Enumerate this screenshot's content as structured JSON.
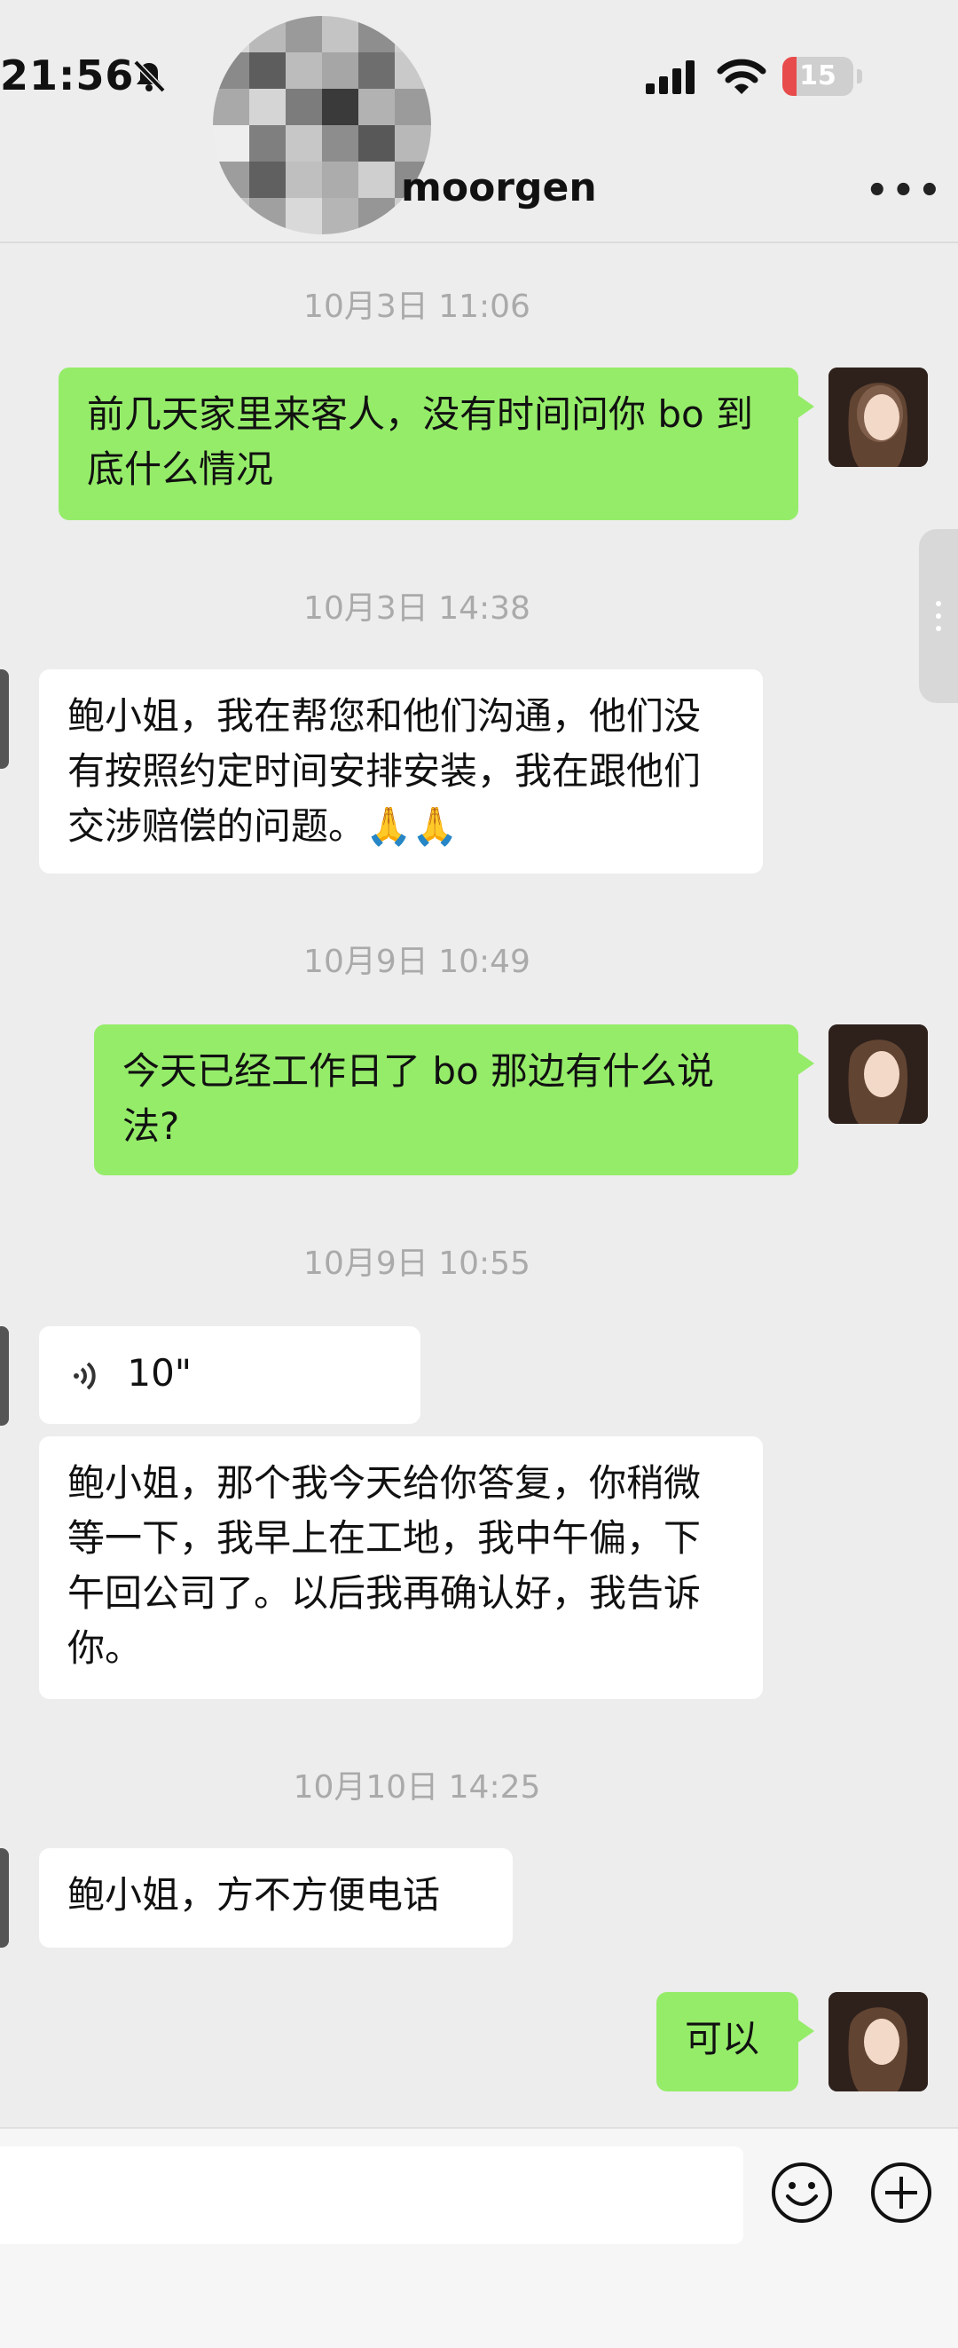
{
  "status_bar": {
    "time": "21:56",
    "battery": "15"
  },
  "header": {
    "contact_name": "moorgen"
  },
  "messages": [
    {
      "timestamp": "10月3日 11:06",
      "from": "me",
      "text": "前几天家里来客人，没有时间问你 bo 到底什么情况"
    },
    {
      "timestamp": "10月3日 14:38",
      "from": "contact",
      "text": "鲍小姐，我在帮您和他们沟通，他们没有按照约定时间安排安装，我在跟他们交涉赔偿的问题。🙏🙏"
    },
    {
      "timestamp": "10月9日 10:49",
      "from": "me",
      "text": "今天已经工作日了 bo 那边有什么说法?"
    },
    {
      "timestamp": "10月9日 10:55",
      "from": "contact",
      "voice_duration": "10\"",
      "text": "鲍小姐，那个我今天给你答复，你稍微等一下，我早上在工地，我中午偏，下午回公司了。以后我再确认好，我告诉你。"
    },
    {
      "timestamp": "10月10日 14:25",
      "from": "contact",
      "text": "鲍小姐，方不方便电话"
    },
    {
      "from": "me",
      "text": "可以"
    }
  ],
  "icons": {
    "mute": "bell-slash-icon",
    "signal": "cellular-signal-icon",
    "wifi": "wifi-icon",
    "more": "more-dots-icon",
    "emoji": "smiley-icon",
    "plus": "plus-circle-icon",
    "voice": "voice-wave-icon"
  },
  "colors": {
    "outgoing_bubble": "#95ec69",
    "incoming_bubble": "#ffffff",
    "background": "#ededed"
  }
}
